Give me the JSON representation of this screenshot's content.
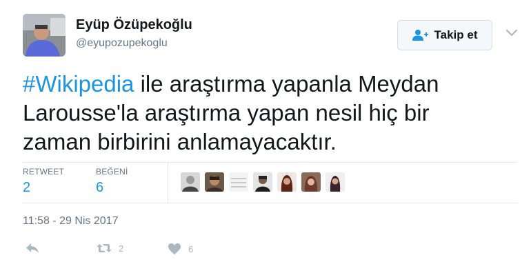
{
  "user": {
    "name": "Eyüp Özüpekoğlu",
    "handle": "@eyupozupekoglu"
  },
  "follow_button": {
    "label": "Takip et",
    "icon": "add-user-icon"
  },
  "tweet": {
    "hashtag": "#Wikipedia",
    "line1_rest": " ile araştırma yapanla Meydan",
    "line2": "Larousse'la araştırma yapan nesil hiç bir",
    "line3": "zaman birbirini anlamayacaktır."
  },
  "stats": {
    "retweet_label": "RETWEET",
    "retweet_count": "2",
    "like_label": "BEĞENİ",
    "like_count": "6"
  },
  "timestamp": "11:58 - 29 Nis 2017",
  "actions": {
    "retweet_count": "2",
    "like_count": "6"
  },
  "colors": {
    "accent": "#1b95e0",
    "muted": "#657786",
    "icon": "#aab8c2",
    "border": "#e1e8ed"
  }
}
